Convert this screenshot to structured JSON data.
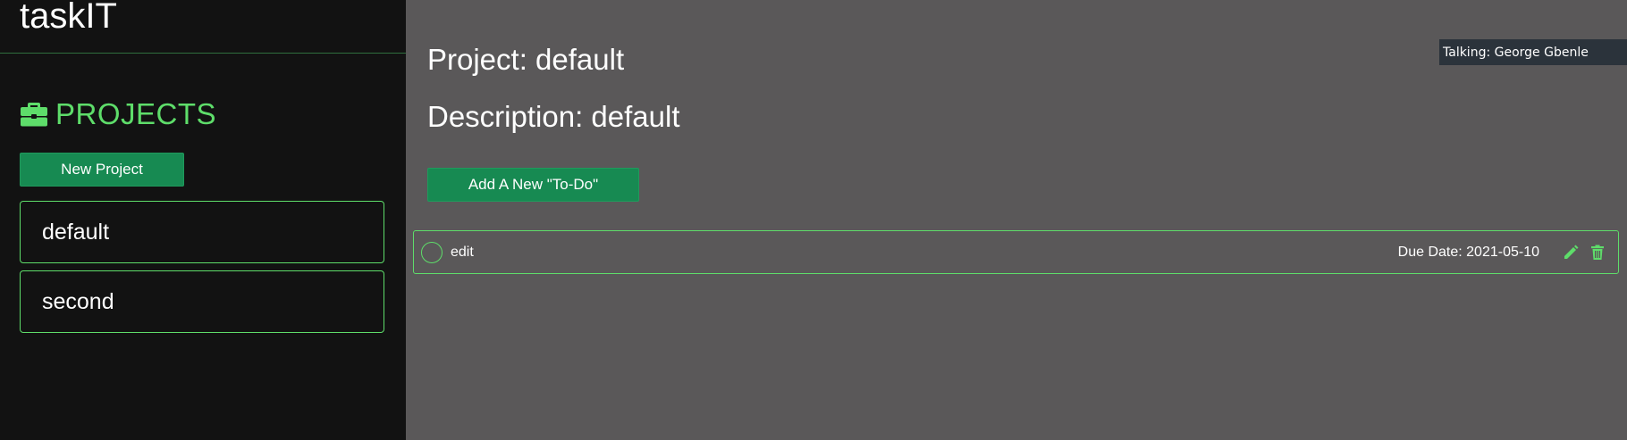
{
  "app": {
    "title": "taskIT"
  },
  "sidebar": {
    "heading": "PROJECTS",
    "heading_icon": "briefcase-icon",
    "new_project_label": "New Project",
    "projects": [
      {
        "label": "default"
      },
      {
        "label": "second"
      }
    ]
  },
  "main": {
    "project_title": "Project: default",
    "description": "Description: default",
    "add_todo_label": "Add A New \"To-Do\"",
    "todos": [
      {
        "title": "edit",
        "due": "Due Date: 2021-05-10",
        "edit_icon": "pencil-icon",
        "delete_icon": "trash-icon"
      }
    ]
  },
  "overlay": {
    "talking": "Talking: George Gbenle"
  },
  "colors": {
    "accent": "#5edd6a",
    "button": "#178a52",
    "sidebar_bg": "#121212",
    "main_bg": "#5a5859"
  }
}
